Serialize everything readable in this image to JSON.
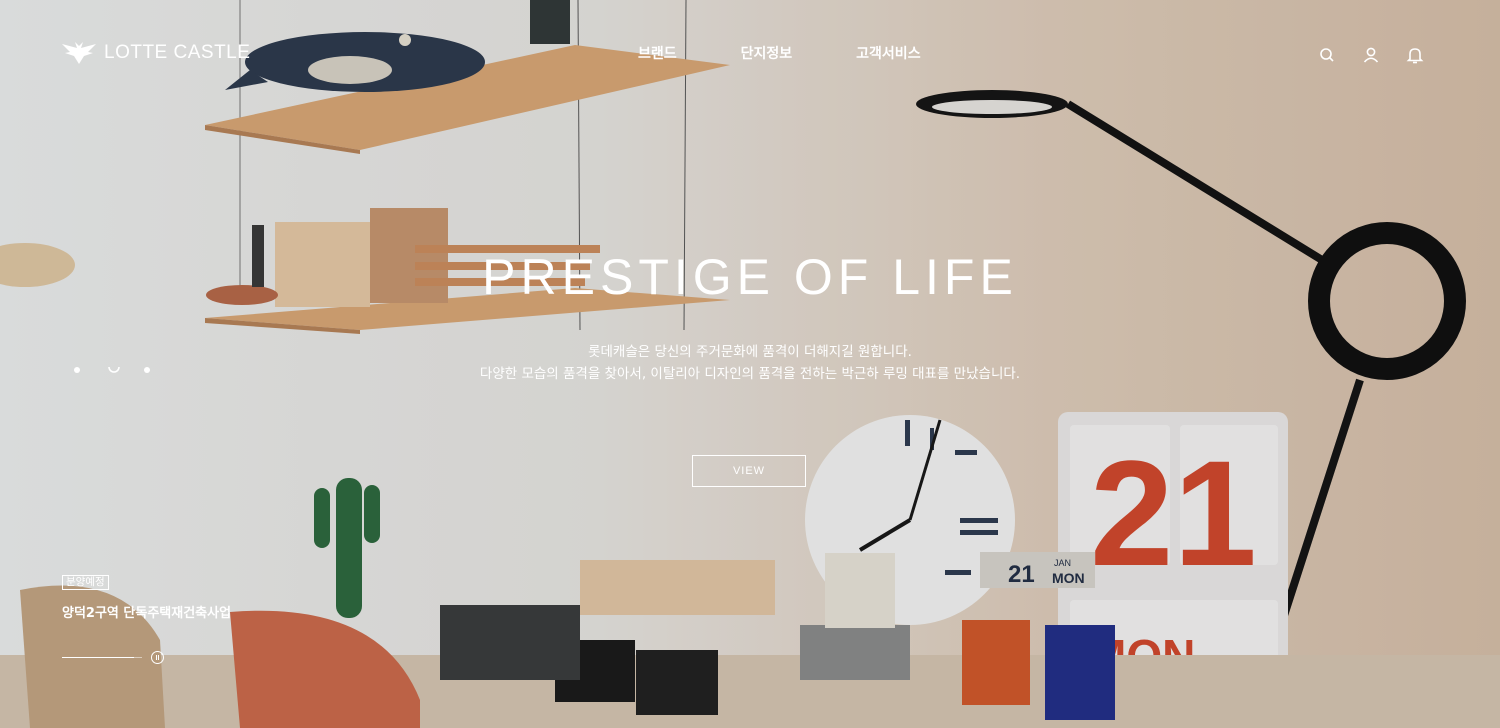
{
  "brand": {
    "logo_text": "LOTTE CASTLE"
  },
  "nav": {
    "items": [
      {
        "label": "브랜드"
      },
      {
        "label": "단지정보"
      },
      {
        "label": "고객서비스"
      }
    ]
  },
  "utility_icons": [
    "search-icon",
    "user-icon",
    "bell-icon"
  ],
  "hero": {
    "title": "PRESTIGE OF LIFE",
    "description_line1": "롯데캐슬은 당신의 주거문화에 품격이 더해지길 원합니다.",
    "description_line2": "다양한 모습의 품격을 찾아서, 이탈리아 디자인의 품격을 전하는 박근하 루밍 대표를 만났습니다.",
    "button_label": "VIEW"
  },
  "slider": {
    "dot_count": 3,
    "active_index": 1,
    "progress": 0.9
  },
  "project": {
    "badge": "분양예정",
    "name": "양덕2구역 단독주택재건축사업"
  },
  "calendar": {
    "day": "21",
    "weekday": "MON",
    "mini_day": "21",
    "mini_month": "JAN",
    "mini_weekday": "MON"
  }
}
